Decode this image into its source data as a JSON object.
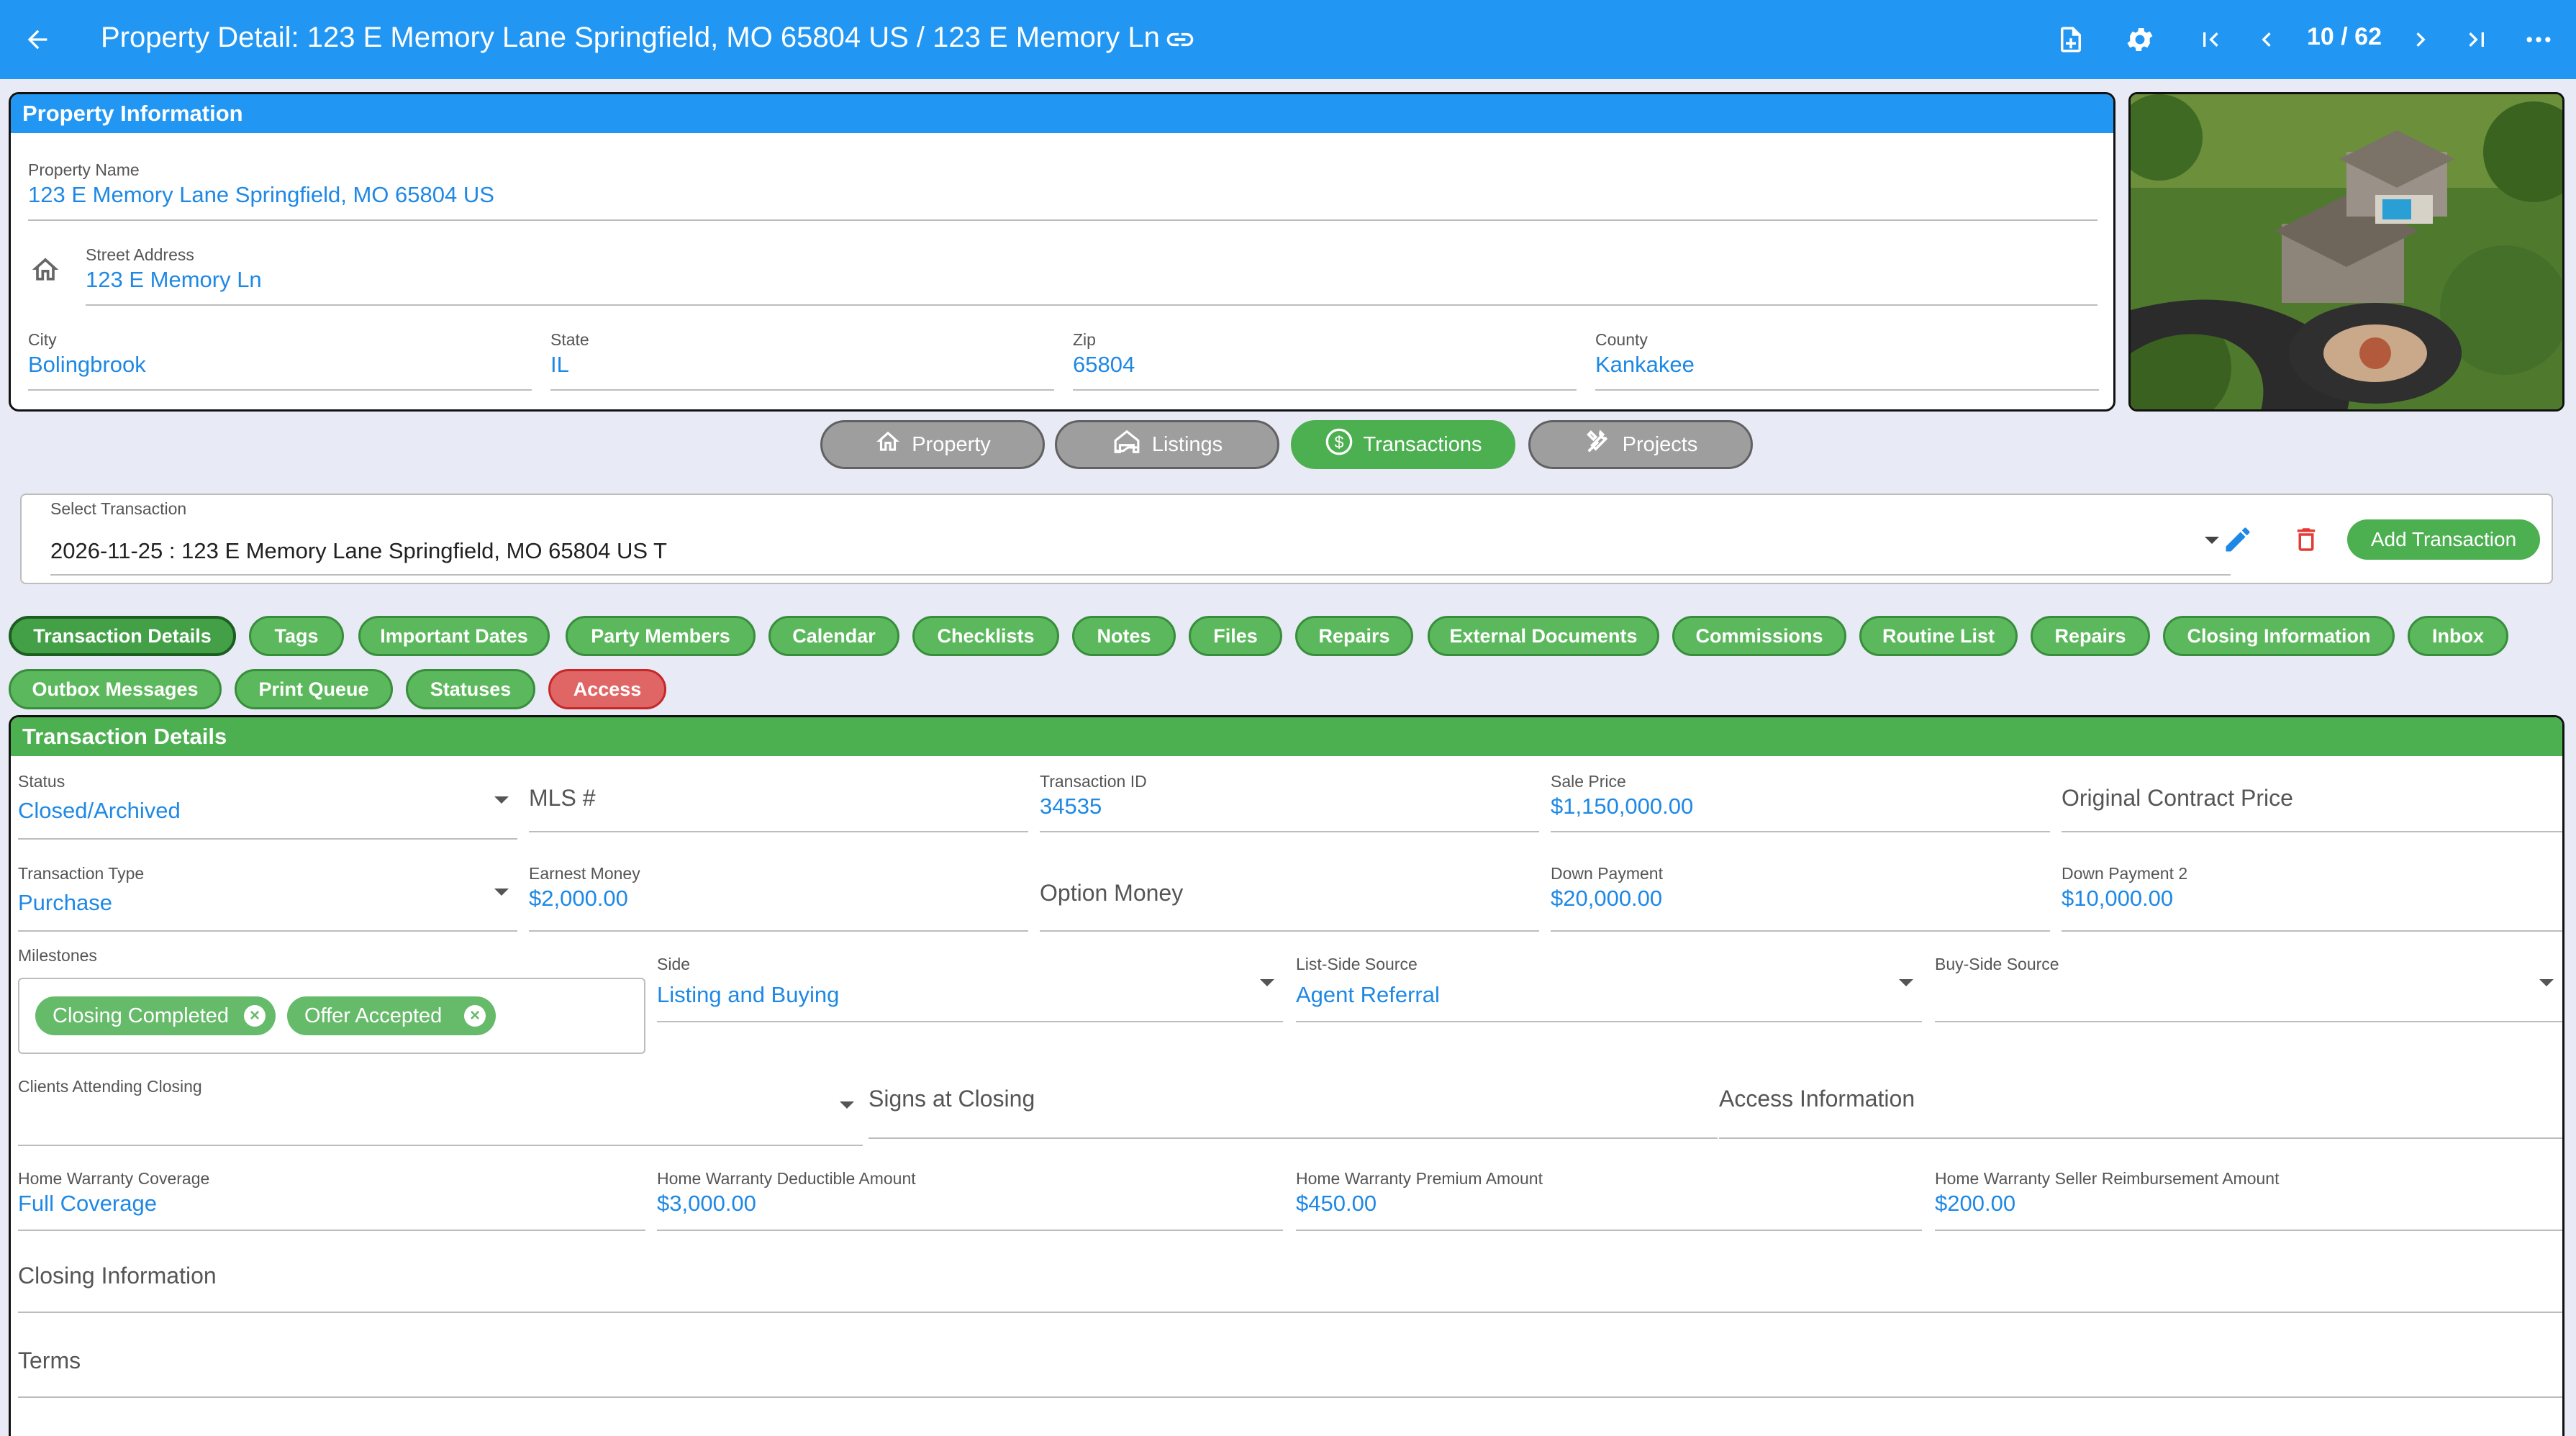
{
  "appbar": {
    "title": "Property Detail: 123 E Memory Lane Springfield, MO 65804 US / 123 E Memory Ln",
    "pager": "10 / 62",
    "icons": [
      "back-arrow-icon",
      "link-icon",
      "new-document-icon",
      "gear-icon",
      "first-page-icon",
      "chevron-left-icon",
      "chevron-right-icon",
      "last-page-icon",
      "more-horizontal-icon"
    ]
  },
  "property": {
    "header": "Property Information",
    "name_label": "Property Name",
    "name_value": "123 E Memory Lane Springfield, MO 65804 US",
    "street_label": "Street Address",
    "street_value": "123 E Memory Ln",
    "city_label": "City",
    "city_value": "Bolingbrook",
    "state_label": "State",
    "state_value": "IL",
    "zip_label": "Zip",
    "zip_value": "65804",
    "county_label": "County",
    "county_value": "Kankakee"
  },
  "section_tabs": [
    {
      "label": "Property",
      "icon": "home-icon",
      "active": false
    },
    {
      "label": "Listings",
      "icon": "listing-house-icon",
      "active": false
    },
    {
      "label": "Transactions",
      "icon": "dollar-circle-icon",
      "active": true
    },
    {
      "label": "Projects",
      "icon": "tools-icon",
      "active": false
    }
  ],
  "select_transaction": {
    "label": "Select Transaction",
    "value": "2026-11-25 : 123 E Memory Lane Springfield, MO 65804 US T",
    "add_label": "Add Transaction"
  },
  "chips": [
    "Transaction Details",
    "Tags",
    "Important Dates",
    "Party Members",
    "Calendar",
    "Checklists",
    "Notes",
    "Files",
    "Repairs",
    "External Documents",
    "Commissions",
    "Routine List",
    "Repairs",
    "Closing Information",
    "Inbox",
    "Outbox Messages",
    "Print Queue",
    "Statuses",
    "Access"
  ],
  "details": {
    "header": "Transaction Details",
    "status_label": "Status",
    "status_value": "Closed/Archived",
    "mls_placeholder": "MLS #",
    "txid_label": "Transaction ID",
    "txid_value": "34535",
    "sale_label": "Sale Price",
    "sale_value": "$1,150,000.00",
    "orig_placeholder": "Original Contract Price",
    "type_label": "Transaction Type",
    "type_value": "Purchase",
    "earnest_label": "Earnest Money",
    "earnest_value": "$2,000.00",
    "option_placeholder": "Option Money",
    "down_label": "Down Payment",
    "down_value": "$20,000.00",
    "down2_label": "Down Payment 2",
    "down2_value": "$10,000.00",
    "milestones_label": "Milestones",
    "milestones": [
      "Closing Completed",
      "Offer Accepted"
    ],
    "side_label": "Side",
    "side_value": "Listing and Buying",
    "list_source_label": "List-Side Source",
    "list_source_value": "Agent Referral",
    "buy_source_label": "Buy-Side Source",
    "buy_source_value": "",
    "clients_label": "Clients Attending Closing",
    "signs_placeholder": "Signs at Closing",
    "access_placeholder": "Access Information",
    "hw_cov_label": "Home Warranty Coverage",
    "hw_cov_value": "Full Coverage",
    "hw_ded_label": "Home Warranty Deductible Amount",
    "hw_ded_value": "$3,000.00",
    "hw_prem_label": "Home Warranty Premium Amount",
    "hw_prem_value": "$450.00",
    "hw_reimb_label": "Home Warranty Seller Reimbursement Amount",
    "hw_reimb_value": "$200.00",
    "closing_placeholder": "Closing Information",
    "terms_placeholder": "Terms"
  },
  "colors": {
    "appbar": "#2196f3",
    "value_text": "#1e88e5",
    "green": "#4caf50",
    "danger": "#e06666",
    "background": "#e8eaf6"
  }
}
